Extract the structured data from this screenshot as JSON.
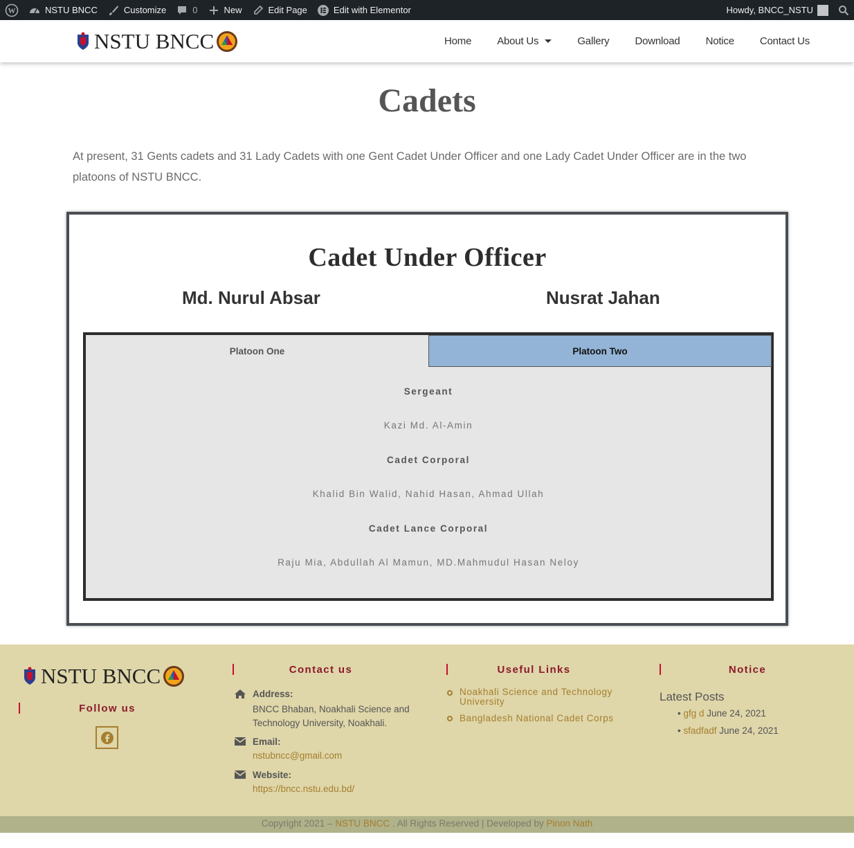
{
  "adminbar": {
    "site": "NSTU BNCC",
    "customize": "Customize",
    "comments": "0",
    "new": "New",
    "edit_page": "Edit Page",
    "edit_elementor": "Edit with Elementor",
    "howdy": "Howdy, BNCC_NSTU"
  },
  "header": {
    "logo_text": "NSTU BNCC",
    "nav": [
      "Home",
      "About Us",
      "Gallery",
      "Download",
      "Notice",
      "Contact Us"
    ]
  },
  "page": {
    "title": "Cadets",
    "intro": "At present, 31 Gents cadets and 31 Lady Cadets with one Gent Cadet Under Officer and one Lady Cadet Under Officer are in the two platoons of NSTU BNCC."
  },
  "cuo": {
    "heading": "Cadet Under Officer",
    "names": [
      "Md. Nurul Absar",
      "Nusrat Jahan"
    ]
  },
  "tabs": {
    "labels": [
      "Platoon One",
      "Platoon Two"
    ],
    "active": "Platoon Two",
    "content": [
      {
        "rank": "Sergeant",
        "names": "Kazi Md. Al-Amin"
      },
      {
        "rank": "Cadet Corporal",
        "names": "Khalid Bin Walid, Nahid Hasan, Ahmad Ullah"
      },
      {
        "rank": "Cadet Lance Corporal",
        "names": "Raju Mia, Abdullah Al Mamun, MD.Mahmudul Hasan Neloy"
      }
    ]
  },
  "footer": {
    "logo_text": "NSTU BNCC",
    "follow": "Follow us",
    "contact": {
      "heading": "Contact us",
      "address_label": "Address:",
      "address": "BNCC Bhaban, Noakhali Science and Technology University, Noakhali.",
      "email_label": "Email:",
      "email": "nstubncc@gmail.com",
      "website_label": "Website:",
      "website": "https://bncc.nstu.edu.bd/"
    },
    "links": {
      "heading": "Useful Links",
      "items": [
        "Noakhali Science and Technology University",
        "Bangladesh National Cadet Corps"
      ]
    },
    "notice": {
      "heading": "Notice",
      "latest": "Latest Posts",
      "posts": [
        {
          "title": "gfg d",
          "date": "June 24, 2021"
        },
        {
          "title": "sfadfadf",
          "date": "June 24, 2021"
        }
      ]
    },
    "copyright": {
      "prefix": "Copyright 2021 – ",
      "site": "NSTU BNCC",
      "middle": " . All Rights Reserved | Developed by ",
      "dev": "Pinon Nath"
    }
  },
  "colors": {
    "admin_bar": "#1d2327",
    "active_tab": "#93b4d6",
    "footer_bg": "#dfd6a9",
    "footer_heading": "#8b1a2b",
    "link_gold": "#a57f2f"
  }
}
